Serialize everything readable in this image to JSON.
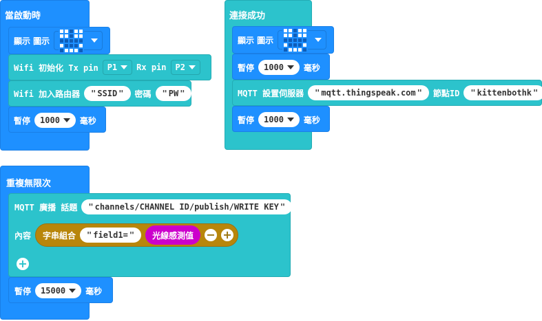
{
  "on_start": {
    "header": "當啟動時",
    "show_icon_label": "顯示 圖示",
    "wifi_init": {
      "label": "Wifi 初始化 Tx pin",
      "tx": "P1",
      "rx_label": "Rx pin",
      "rx": "P2"
    },
    "wifi_router": {
      "label": "Wifi 加入路由器",
      "ssid": "SSID",
      "pw_label": "密碼",
      "pw": "PW"
    },
    "pause": {
      "label": "暫停",
      "value": "1000",
      "unit": "毫秒"
    }
  },
  "on_connected": {
    "header": "連接成功",
    "show_icon_label": "顯示 圖示",
    "pause1": {
      "label": "暫停",
      "value": "1000",
      "unit": "毫秒"
    },
    "mqtt_server": {
      "label": "MQTT 設置伺服器",
      "server": "mqtt.thingspeak.com",
      "node_label": "節點ID",
      "node": "kittenbothk"
    },
    "pause2": {
      "label": "暫停",
      "value": "1000",
      "unit": "毫秒"
    }
  },
  "forever": {
    "header": "重複無限次",
    "mqtt_publish": {
      "label": "MQTT 廣播 話題",
      "topic": "channels/CHANNEL ID/publish/WRITE KEY"
    },
    "content": {
      "label": "內容",
      "join_label": "字串組合",
      "field": "field1=",
      "sensor": "光線感測值"
    },
    "pause": {
      "label": "暫停",
      "value": "15000",
      "unit": "毫秒"
    }
  },
  "colors": {
    "basic": "#1e90ff",
    "iot": "#2cc3cc",
    "text": "#b8860b",
    "sensor": "#cc00cc"
  },
  "icons": {
    "plus": "plus-icon",
    "minus": "minus-icon",
    "caret": "caret-down-icon"
  }
}
